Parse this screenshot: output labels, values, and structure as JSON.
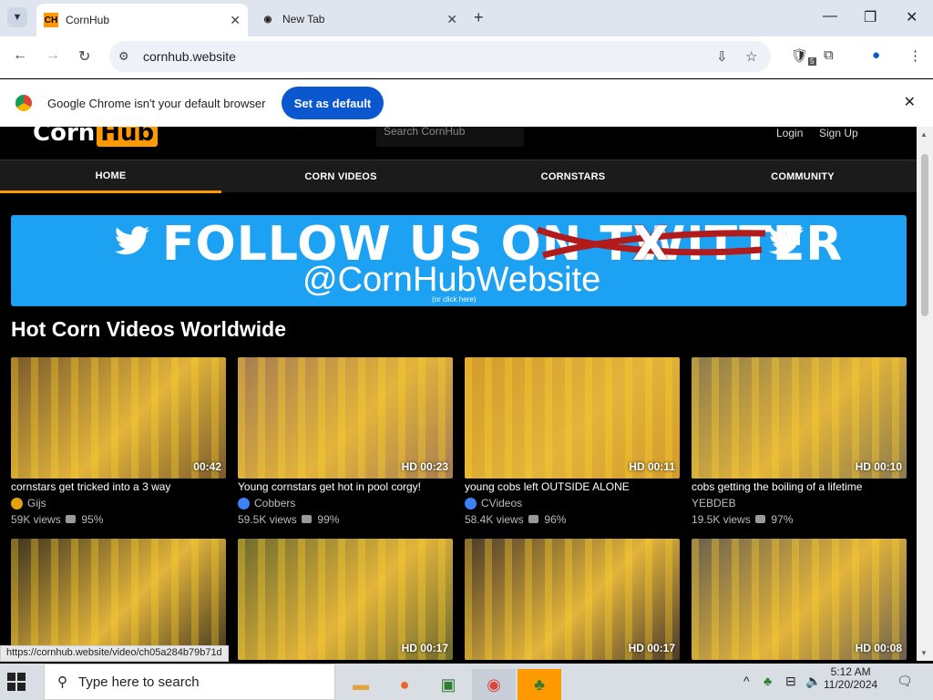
{
  "browser": {
    "tabs": [
      {
        "title": "CornHub",
        "active": true,
        "favicon_text": "CH"
      },
      {
        "title": "New Tab",
        "active": false
      }
    ],
    "url": "cornhub.website",
    "extension_badge": "5",
    "infobar": {
      "message": "Google Chrome isn't your default browser",
      "button": "Set as default"
    },
    "status_url": "https://cornhub.website/video/ch05a284b79b71d"
  },
  "site": {
    "logo_a": "Corn",
    "logo_b": "Hub",
    "search_placeholder": "Search CornHub",
    "login": "Login",
    "signup": "Sign Up",
    "nav": [
      {
        "label": "HOME",
        "active": true
      },
      {
        "label": "CORN VIDEOS",
        "active": false
      },
      {
        "label": "CORNSTARS",
        "active": false
      },
      {
        "label": "COMMUNITY",
        "active": false
      }
    ],
    "banner": {
      "headline": "FOLLOW US ON TWITTER",
      "strike_letter": "X",
      "handle": "@CornHubWebsite",
      "note": "(or click here)"
    },
    "section_title": "Hot Corn Videos Worldwide",
    "videos": [
      {
        "title": "cornstars get tricked into a 3 way",
        "duration": "00:42",
        "channel": "Gijs",
        "verified": "orange",
        "views": "59K views",
        "rating": "95%",
        "bg": "#7a5a2c"
      },
      {
        "title": "Young cornstars get hot in pool corgy!",
        "duration": "HD 00:23",
        "channel": "Cobbers",
        "verified": "blue",
        "views": "59.5K views",
        "rating": "99%",
        "bg": "#a67c52"
      },
      {
        "title": "young cobs left OUTSIDE ALONE",
        "duration": "HD 00:11",
        "channel": "CVideos",
        "verified": "blue",
        "views": "58.4K views",
        "rating": "96%",
        "bg": "#d39b2b"
      },
      {
        "title": "cobs getting the boiling of a lifetime",
        "duration": "HD 00:10",
        "channel": "YEBDEB",
        "verified": "",
        "views": "19.5K views",
        "rating": "97%",
        "bg": "#8c7a4d"
      },
      {
        "title": "",
        "duration": "",
        "channel": "",
        "verified": "",
        "views": "",
        "rating": "",
        "bg": "#3d3320"
      },
      {
        "title": "",
        "duration": "HD 00:17",
        "channel": "",
        "verified": "",
        "views": "",
        "rating": "",
        "bg": "#6e6a2e"
      },
      {
        "title": "",
        "duration": "HD 00:17",
        "channel": "",
        "verified": "",
        "views": "",
        "rating": "",
        "bg": "#4b3a2a"
      },
      {
        "title": "",
        "duration": "HD 00:08",
        "channel": "",
        "verified": "",
        "views": "",
        "rating": "",
        "bg": "#6b604e"
      }
    ]
  },
  "taskbar": {
    "search_placeholder": "Type here to search",
    "time": "5:12 AM",
    "date": "11/20/2024"
  }
}
